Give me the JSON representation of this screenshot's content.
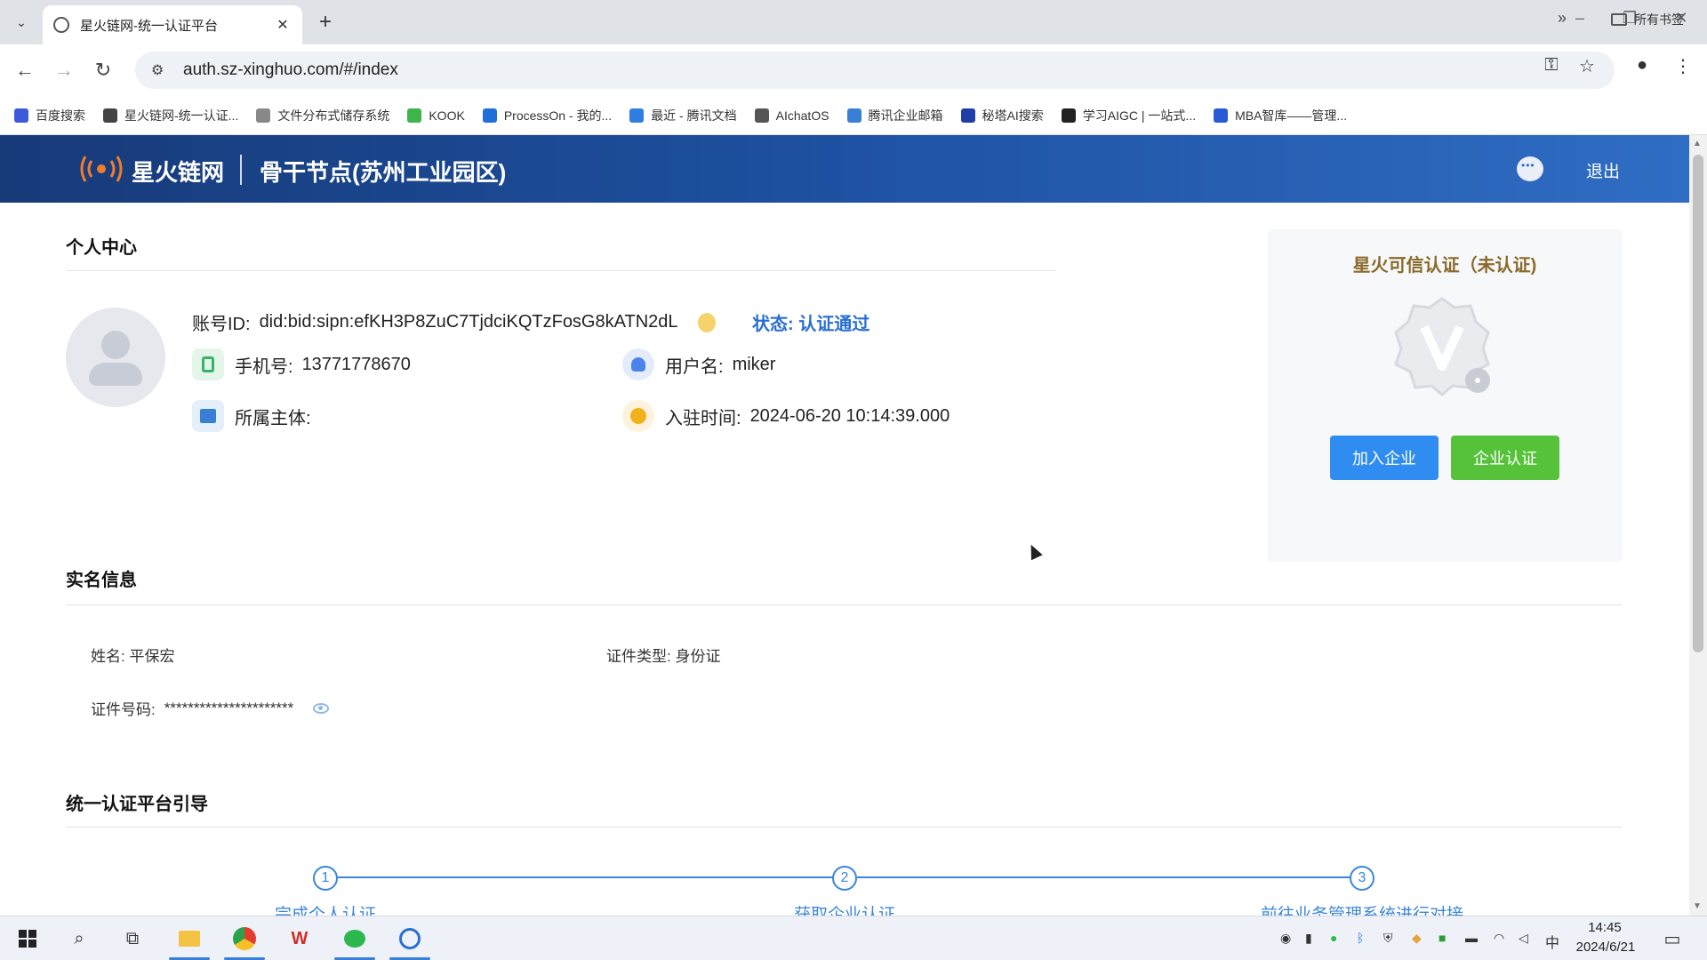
{
  "browser": {
    "tab_title": "星火链网-统一认证平台",
    "url": "auth.sz-xinghuo.com/#/index",
    "bookmarks": [
      {
        "label": "百度搜索",
        "color": "#3b5bdb"
      },
      {
        "label": "星火链网-统一认证...",
        "color": "#444444"
      },
      {
        "label": "文件分布式储存系统",
        "color": "#888888"
      },
      {
        "label": "KOOK",
        "color": "#3db54a"
      },
      {
        "label": "ProcessOn - 我的...",
        "color": "#1e6fd9"
      },
      {
        "label": "最近 - 腾讯文档",
        "color": "#2f7de1"
      },
      {
        "label": "AIchatOS",
        "color": "#555555"
      },
      {
        "label": "腾讯企业邮箱",
        "color": "#3a7fd6"
      },
      {
        "label": "秘塔AI搜索",
        "color": "#1f3fa8"
      },
      {
        "label": "学习AIGC | 一站式...",
        "color": "#222222"
      },
      {
        "label": "MBA智库——管理...",
        "color": "#2a5bd7"
      }
    ],
    "all_bookmarks_label": "所有书签"
  },
  "header": {
    "brand": "星火链网",
    "node": "骨干节点(苏州工业园区)",
    "logout": "退出"
  },
  "profile": {
    "section_title": "个人中心",
    "account_id_label": "账号ID:",
    "account_id": "did:bid:sipn:efKH3P8ZuC7TjdciKQTzFosG8kATN2dL",
    "status_label": "状态:",
    "status_value": "认证通过",
    "phone_label": "手机号:",
    "phone": "13771778670",
    "username_label": "用户名:",
    "username": "miker",
    "org_label": "所属主体:",
    "org": "",
    "join_time_label": "入驻时间:",
    "join_time": "2024-06-20 10:14:39.000"
  },
  "trust_card": {
    "title": "星火可信认证（未认证)",
    "join_button": "加入企业",
    "cert_button": "企业认证"
  },
  "realname": {
    "section_title": "实名信息",
    "name": "姓名: 平保宏",
    "id_type": "证件类型: 身份证",
    "id_number_label": "证件号码:",
    "id_number": "**********************"
  },
  "guide": {
    "section_title": "统一认证平台引导",
    "steps": [
      {
        "num": "1",
        "label": "完成个人认证"
      },
      {
        "num": "2",
        "label": "获取企业认证"
      },
      {
        "num": "3",
        "label": "前往业务管理系统进行对接"
      }
    ]
  },
  "taskbar": {
    "time": "14:45",
    "date": "2024/6/21",
    "ime": "中"
  }
}
